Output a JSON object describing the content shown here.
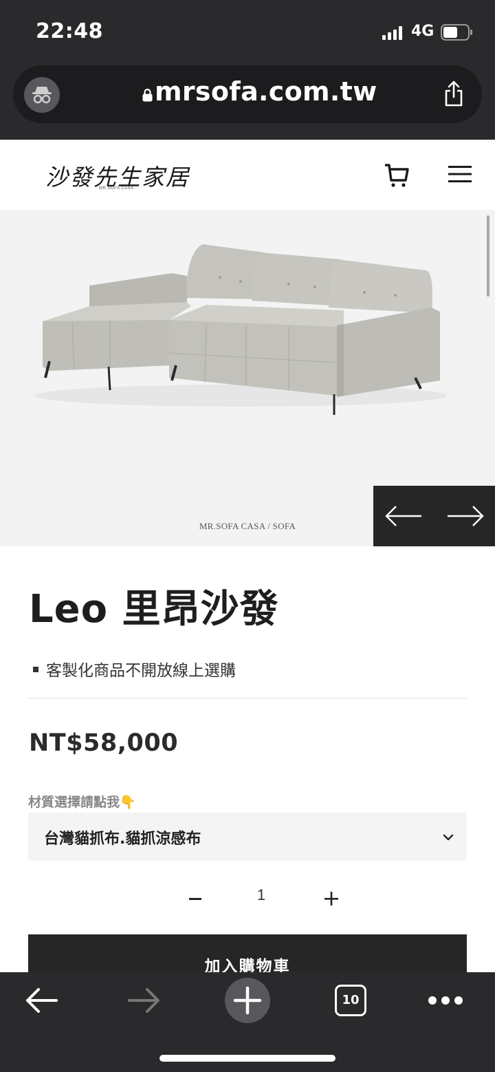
{
  "status_bar": {
    "time": "22:48",
    "network": "4G"
  },
  "browser": {
    "url": "mrsofa.com.tw",
    "tab_count": "10"
  },
  "site": {
    "logo_text": "沙發先生家居",
    "logo_subtext": "MR.SOFA CASA"
  },
  "hero": {
    "caption": "MR.SOFA CASA / SOFA"
  },
  "product": {
    "title": "Leo 里昂沙發",
    "note": "客製化商品不開放線上選購",
    "price": "NT$58,000",
    "material_label": "材質選擇請點我👇",
    "material_value": "台灣貓抓布.貓抓涼感布",
    "quantity": "1",
    "add_to_cart": "加入購物車"
  },
  "colors": {
    "dark": "#262626",
    "browser_bg": "#2a2a2c",
    "hero_bg": "#f3f3f3"
  }
}
